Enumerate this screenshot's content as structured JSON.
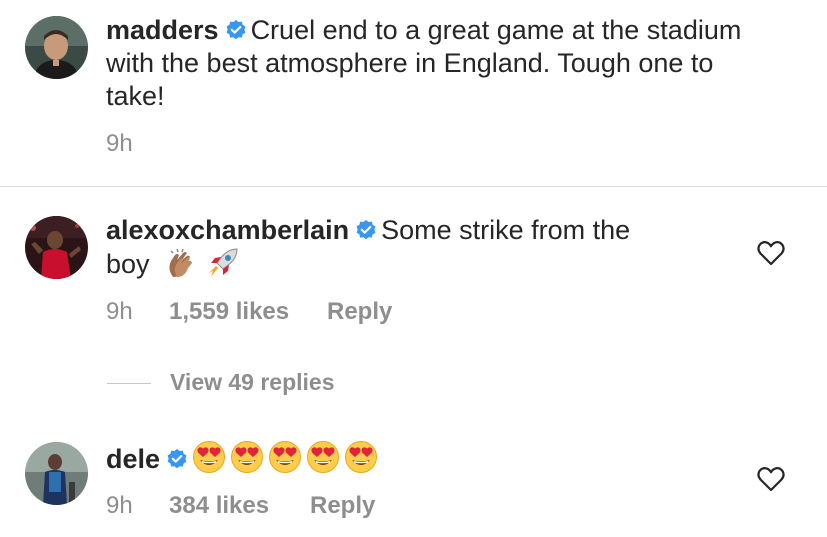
{
  "comments": [
    {
      "username": "madders",
      "text_line1": "Cruel end to a great game at the stadium",
      "text_line2": "with the best atmosphere in England. Tough one to",
      "text_line3": "take!",
      "time": "9h"
    },
    {
      "username": "alexoxchamberlain",
      "text_line1": "Some strike from the",
      "text_line2": "boy",
      "emojis": [
        "clapping-hands",
        "rocket"
      ],
      "time": "9h",
      "likes": "1,559 likes",
      "reply_label": "Reply",
      "view_replies": "View 49 replies"
    },
    {
      "username": "dele",
      "emojis": [
        "heart-eyes",
        "heart-eyes",
        "heart-eyes",
        "heart-eyes",
        "heart-eyes"
      ],
      "time": "9h",
      "likes": "384 likes",
      "reply_label": "Reply"
    }
  ],
  "colors": {
    "text": "#262626",
    "secondary": "#8e8e8e",
    "verified_badge": "#3897f0",
    "divider": "#dbdbdb"
  }
}
